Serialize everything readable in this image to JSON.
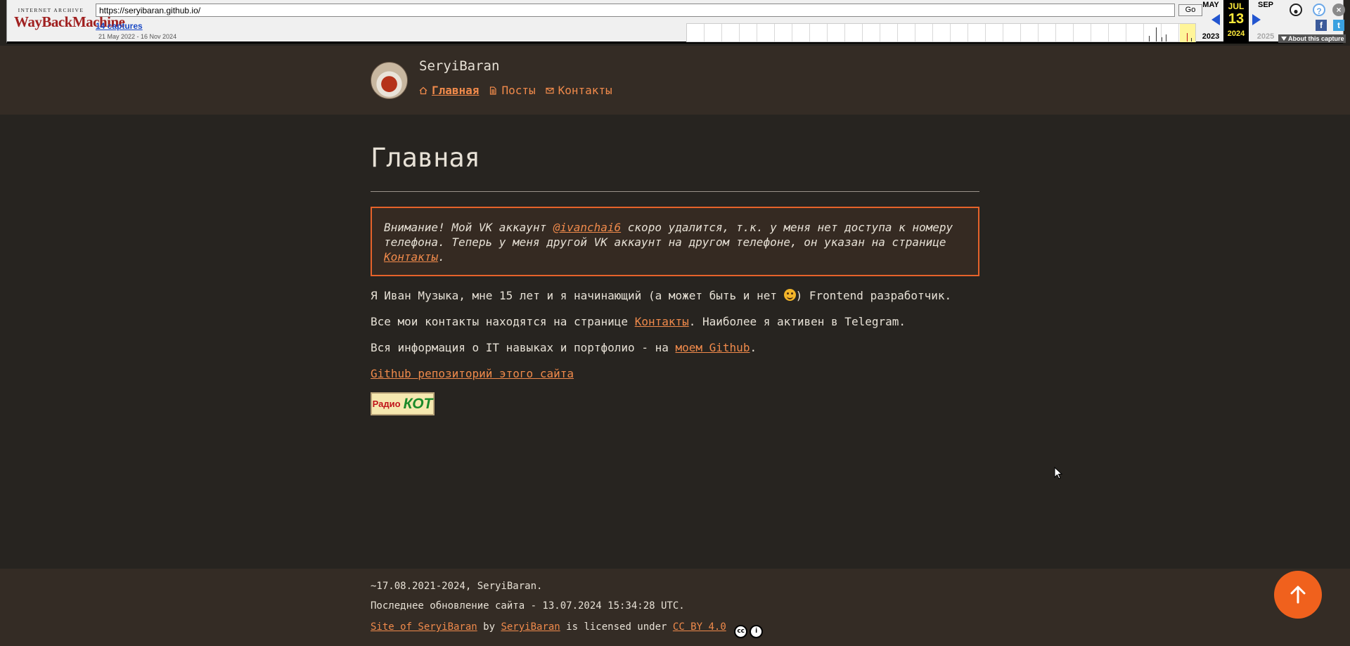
{
  "wayback": {
    "logo_top": "INTERNET ARCHIVE",
    "logo_main": "WayBackMachine",
    "url": "https://seryibaran.github.io/",
    "go_label": "Go",
    "captures": "14 captures",
    "range": "21 May 2022 - 16 Nov 2024",
    "prev_month": "MAY",
    "cur_month": "JUL",
    "next_month": "SEP",
    "cur_day": "13",
    "prev_year": "2023",
    "cur_year": "2024",
    "next_year": "2025",
    "about": "About this capture",
    "colors": {
      "accent": "#2255d0",
      "highlight": "#ffeb3b"
    }
  },
  "header": {
    "site_title": "SeryiBaran",
    "nav": [
      {
        "label": "Главная",
        "icon": "home-icon",
        "active": true
      },
      {
        "label": "Посты",
        "icon": "document-icon",
        "active": false
      },
      {
        "label": "Контакты",
        "icon": "mail-icon",
        "active": false
      }
    ]
  },
  "main": {
    "title": "Главная",
    "notice": {
      "t1": "Внимание! Мой VK аккаунт ",
      "vk_link": "@ivanchai6",
      "t2": " скоро удалится, т.к. у меня нет доступа к номеру телефона. Теперь у меня другой VK аккаунт на другом телефоне, он указан на странице ",
      "contacts_link": "Контакты",
      "t3": "."
    },
    "p1": {
      "a": "Я Иван Музыка, мне 15 лет и я начинающий (а может быть и нет ",
      "b": ") Frontend разработчик."
    },
    "p2": {
      "a": "Все мои контакты находятся на странице ",
      "link": "Контакты",
      "b": ". Наиболее я активен в Telegram."
    },
    "p3": {
      "a": "Вся информация о IT навыках и портфолио - на ",
      "link": "моем Github",
      "b": "."
    },
    "p4": {
      "link": "Github репозиторий этого сайта"
    },
    "badge": {
      "part1": "Радио",
      "part2": "КОТ"
    }
  },
  "footer": {
    "line1": "~17.08.2021-2024, SeryiBaran.",
    "line2": "Последнее обновление сайта - 13.07.2024 15:34:28 UTC.",
    "line3": {
      "site_link": "Site of SeryiBaran",
      "by": " by ",
      "author_link": "SeryiBaran",
      "licensed": " is licensed under ",
      "license_link": "CC BY 4.0"
    }
  },
  "colors": {
    "background": "#272420",
    "header_bg": "#342c25",
    "accent": "#f08a4b",
    "button": "#f0611d"
  }
}
